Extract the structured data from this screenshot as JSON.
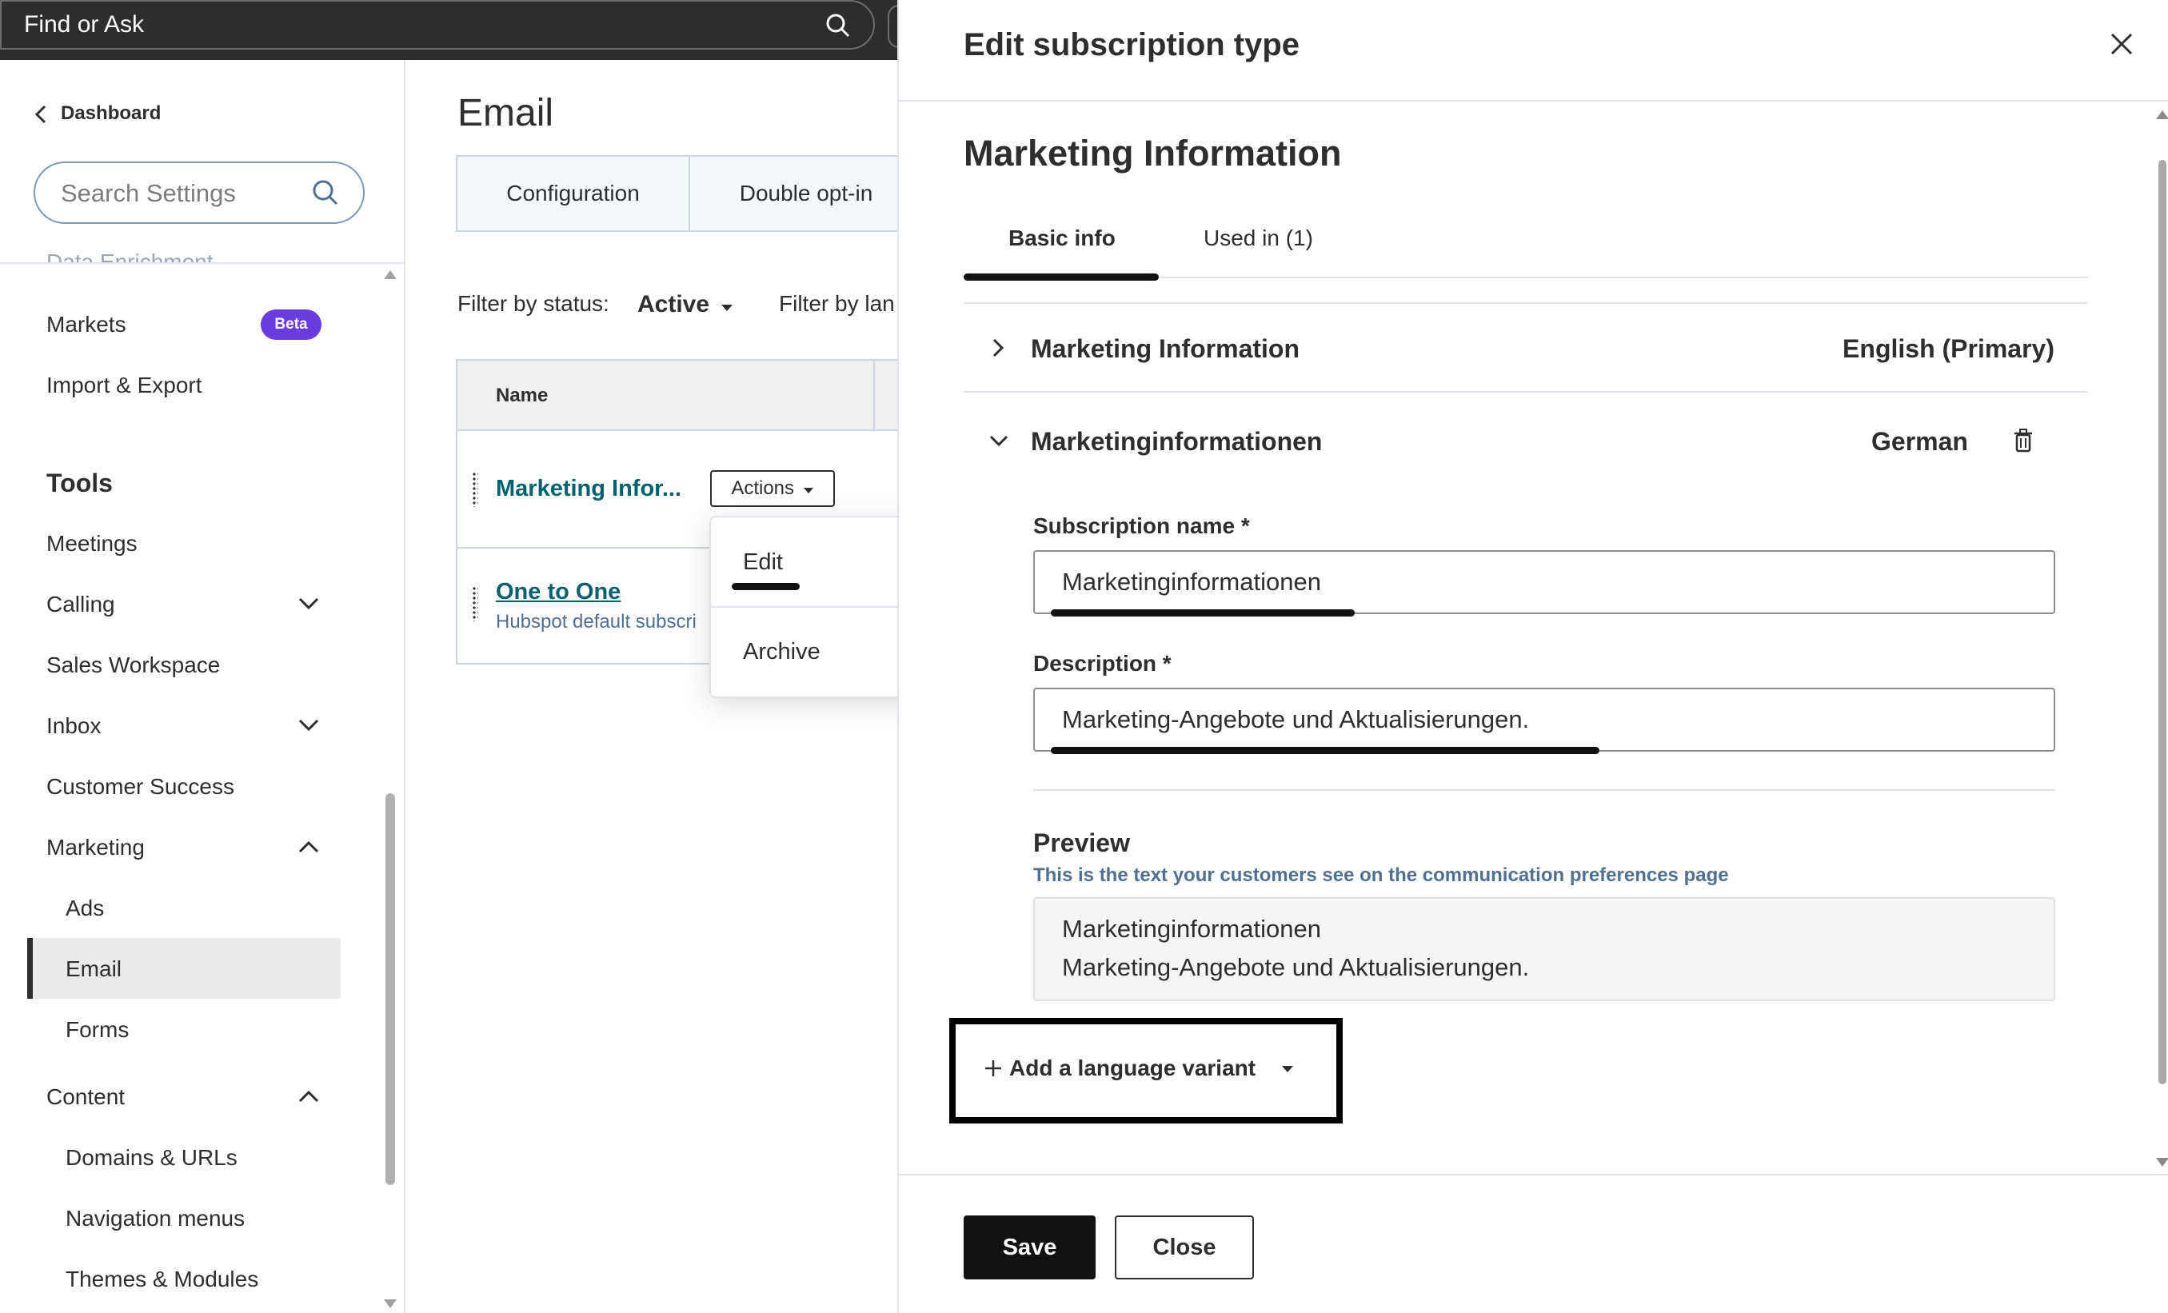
{
  "topbar": {
    "search_placeholder": "Find or Ask",
    "search_icon": "search-icon"
  },
  "sidebar": {
    "back_label": "Dashboard",
    "search_placeholder": "Search Settings",
    "cut_item": "Data Enrichment",
    "items": [
      {
        "label": "Markets",
        "badge": "Beta"
      },
      {
        "label": "Import & Export"
      }
    ],
    "tools_heading": "Tools",
    "tools": [
      {
        "label": "Meetings"
      },
      {
        "label": "Calling",
        "expand": "chevron-down-icon"
      },
      {
        "label": "Sales Workspace"
      },
      {
        "label": "Inbox",
        "expand": "chevron-down-icon"
      },
      {
        "label": "Customer Success"
      },
      {
        "label": "Marketing",
        "expand": "chevron-up-icon"
      },
      {
        "label": "Ads"
      },
      {
        "label": "Email",
        "active": true
      },
      {
        "label": "Forms"
      },
      {
        "label": "Content",
        "expand": "chevron-up-icon"
      },
      {
        "label": "Domains & URLs"
      },
      {
        "label": "Navigation menus"
      },
      {
        "label": "Themes & Modules"
      }
    ]
  },
  "main": {
    "title": "Email",
    "tabs": [
      "Configuration",
      "Double opt-in"
    ],
    "filter_status_label": "Filter by status:",
    "filter_status_value": "Active",
    "filter_language_label": "Filter by lan",
    "table": {
      "column_name": "Name",
      "rows": [
        {
          "name": "Marketing Infor...",
          "actions": "Actions"
        },
        {
          "name": "One to One",
          "description": "Hubspot default subscri"
        }
      ]
    },
    "actions_menu": [
      "Edit",
      "Archive"
    ]
  },
  "panel": {
    "title": "Edit subscription type",
    "subtitle": "Marketing Information",
    "tabs": [
      "Basic info",
      "Used in (1)"
    ],
    "accordion": [
      {
        "title": "Marketing Information",
        "language": "English (Primary)",
        "expanded": false
      },
      {
        "title": "Marketinginformationen",
        "language": "German",
        "expanded": true
      }
    ],
    "subscription_name_label": "Subscription name *",
    "subscription_name_value": "Marketinginformationen",
    "description_label": "Description *",
    "description_value": "Marketing-Angebote und Aktualisierungen.",
    "preview_heading": "Preview",
    "preview_subtext": "This is the text your customers see on the communication preferences page",
    "preview_line1": "Marketinginformationen",
    "preview_line2": "Marketing-Angebote und Aktualisierungen.",
    "add_variant": "Add a language variant",
    "save": "Save",
    "close": "Close"
  },
  "colors": {
    "badge": "#6a3cdf",
    "link": "#00616e",
    "primary_button": "#111111"
  }
}
